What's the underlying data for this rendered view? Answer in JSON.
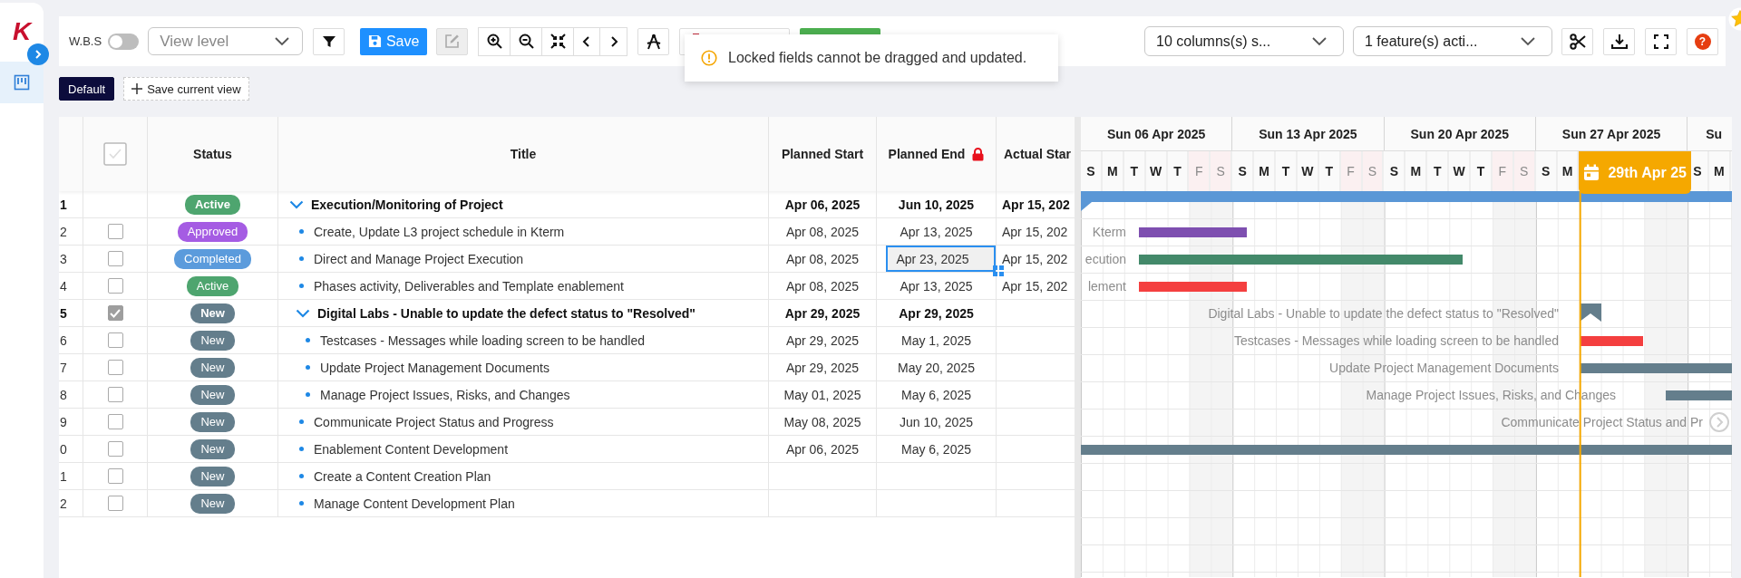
{
  "sidebar": {
    "logo": "K",
    "items": [
      {
        "selected": true
      }
    ]
  },
  "toolbar": {
    "wbs_label": "W.B.S",
    "wbs_on": false,
    "view_level_placeholder": "View level",
    "save_label": "Save",
    "edit_disabled": true,
    "columns_select": "10 columns(s) s...",
    "features_select": "1 feature(s) acti...",
    "help": "?"
  },
  "views": [
    {
      "kind": "view",
      "label": "Default",
      "selected": true
    },
    {
      "kind": "add",
      "label": "Save current view"
    }
  ],
  "toast": {
    "kind": "warning",
    "message": "Locked fields cannot be dragged and updated."
  },
  "table": {
    "select_all_disabled": true,
    "columns": [
      {
        "label": "Status"
      },
      {
        "label": "Title"
      },
      {
        "label": "Planned Start"
      },
      {
        "label": "Planned End",
        "locked": true
      },
      {
        "label": "Actual Star"
      }
    ],
    "rows": [
      {
        "num": "1",
        "status": {
          "label": "Active",
          "color": "#4ea56f"
        },
        "title": "Execution/Monitoring of Project",
        "planned_start": "Apr 06, 2025",
        "planned_end": "Jun 10, 2025",
        "end_selected": false,
        "actual_start": "Apr 15, 202",
        "expanded": true,
        "children": [
          {
            "num": "2",
            "checked": false,
            "status": {
              "label": "Approved",
              "color": "#a55ce3"
            },
            "title": "Create, Update L3 project schedule in Kterm",
            "planned_start": "Apr 08, 2025",
            "planned_end": "Apr 13, 2025",
            "end_selected": false,
            "actual_start": "Apr 15, 202"
          },
          {
            "num": "3",
            "checked": false,
            "status": {
              "label": "Completed",
              "color": "#5b9bdc"
            },
            "title": "Direct and Manage Project Execution",
            "planned_start": "Apr 08, 2025",
            "planned_end": "Apr 23, 2025",
            "end_selected": true,
            "actual_start": "Apr 15, 202"
          },
          {
            "num": "4",
            "checked": false,
            "status": {
              "label": "Active",
              "color": "#4ea56f"
            },
            "title": "Phases activity, Deliverables and Template enablement",
            "planned_start": "Apr 08, 2025",
            "planned_end": "Apr 13, 2025",
            "end_selected": false,
            "actual_start": "Apr 15, 202"
          },
          {
            "num": "5",
            "checked": true,
            "status": {
              "label": "New",
              "color": "#647e8c"
            },
            "title": "Digital Labs - Unable to update the defect status to \"Resolved\"",
            "planned_start": "Apr 29, 2025",
            "planned_end": "Apr 29, 2025",
            "end_selected": false,
            "expanded": true,
            "children": [
              {
                "num": "6",
                "checked": false,
                "status": {
                  "label": "New",
                  "color": "#647e8c"
                },
                "title": "Testcases - Messages while loading screen to be handled",
                "planned_start": "Apr 29, 2025",
                "planned_end": "May 1, 2025",
                "end_selected": false
              },
              {
                "num": "7",
                "checked": false,
                "status": {
                  "label": "New",
                  "color": "#647e8c"
                },
                "title": "Update Project Management Documents",
                "planned_start": "Apr 29, 2025",
                "planned_end": "May 20, 2025",
                "end_selected": false
              },
              {
                "num": "8",
                "checked": false,
                "status": {
                  "label": "New",
                  "color": "#647e8c"
                },
                "title": "Manage Project Issues, Risks, and Changes",
                "planned_start": "May 01, 2025",
                "planned_end": "May 6, 2025",
                "end_selected": false
              }
            ]
          },
          {
            "num": "9",
            "checked": false,
            "status": {
              "label": "New",
              "color": "#647e8c"
            },
            "title": "Communicate Project Status and Progress",
            "planned_start": "May 08, 2025",
            "planned_end": "Jun 10, 2025",
            "end_selected": false
          },
          {
            "num": "0",
            "checked": false,
            "status": {
              "label": "New",
              "color": "#647e8c"
            },
            "title": "Enablement Content Development",
            "planned_start": "Apr 06, 2025",
            "planned_end": "May 6, 2025",
            "end_selected": false
          },
          {
            "num": "1",
            "checked": false,
            "status": {
              "label": "New",
              "color": "#647e8c"
            },
            "title": "Create a Content Creation Plan"
          },
          {
            "num": "2",
            "checked": false,
            "status": {
              "label": "New",
              "color": "#647e8c"
            },
            "title": "Manage Content Development Plan"
          }
        ]
      }
    ]
  },
  "gantt": {
    "weeks": [
      "Sun 06 Apr 2025",
      "Sun 13 Apr 2025",
      "Sun 20 Apr 2025",
      "Sun 27 Apr 2025",
      "Su"
    ],
    "days": [
      {
        "kind": "day",
        "letter": "S",
        "weekend": false
      },
      {
        "kind": "day",
        "letter": "M",
        "weekend": false
      },
      {
        "kind": "day",
        "letter": "T",
        "weekend": false
      },
      {
        "kind": "day",
        "letter": "W",
        "weekend": false
      },
      {
        "kind": "day",
        "letter": "T",
        "weekend": false
      },
      {
        "kind": "day",
        "letter": "F",
        "weekend": true
      },
      {
        "kind": "day",
        "letter": "S",
        "weekend": true
      },
      {
        "kind": "day",
        "letter": "S",
        "weekend": false
      },
      {
        "kind": "day",
        "letter": "M",
        "weekend": false
      },
      {
        "kind": "day",
        "letter": "T",
        "weekend": false
      },
      {
        "kind": "day",
        "letter": "W",
        "weekend": false
      },
      {
        "kind": "day",
        "letter": "T",
        "weekend": false
      },
      {
        "kind": "day",
        "letter": "F",
        "weekend": true
      },
      {
        "kind": "day",
        "letter": "S",
        "weekend": true
      },
      {
        "kind": "day",
        "letter": "S",
        "weekend": false
      },
      {
        "kind": "day",
        "letter": "M",
        "weekend": false
      },
      {
        "kind": "day",
        "letter": "T",
        "weekend": false
      },
      {
        "kind": "day",
        "letter": "W",
        "weekend": false
      },
      {
        "kind": "day",
        "letter": "T",
        "weekend": false
      },
      {
        "kind": "day",
        "letter": "F",
        "weekend": true
      },
      {
        "kind": "day",
        "letter": "S",
        "weekend": true
      },
      {
        "kind": "day",
        "letter": "S",
        "weekend": false
      },
      {
        "kind": "day",
        "letter": "M",
        "weekend": false
      },
      {
        "kind": "today",
        "label": "29th Apr 25"
      },
      {
        "kind": "day",
        "letter": "S",
        "weekend": false
      },
      {
        "kind": "day",
        "letter": "M",
        "weekend": false
      }
    ],
    "rows": [
      {
        "kind": "summary",
        "color": "#5a97d6"
      },
      {
        "kind": "bar",
        "label": "Kterm",
        "color": "#7e4fb0"
      },
      {
        "kind": "bar",
        "label": "ecution",
        "color": "#43896a"
      },
      {
        "kind": "bar",
        "label": "lement",
        "color": "#f43f3f"
      },
      {
        "kind": "milestone",
        "label": "Digital Labs - Unable to update the defect status to \"Resolved\"",
        "color": "#647e8c"
      },
      {
        "kind": "bar",
        "label": "Testcases - Messages while loading screen to be handled",
        "color": "#f43f3f"
      },
      {
        "kind": "bar",
        "label": "Update Project Management Documents",
        "color": "#647e8c"
      },
      {
        "kind": "bar",
        "label": "Manage Project Issues, Risks, and Changes",
        "color": "#647e8c"
      },
      {
        "kind": "label",
        "label": "Communicate Project Status and Pr"
      },
      {
        "kind": "bar",
        "color": "#647e8c"
      }
    ]
  }
}
